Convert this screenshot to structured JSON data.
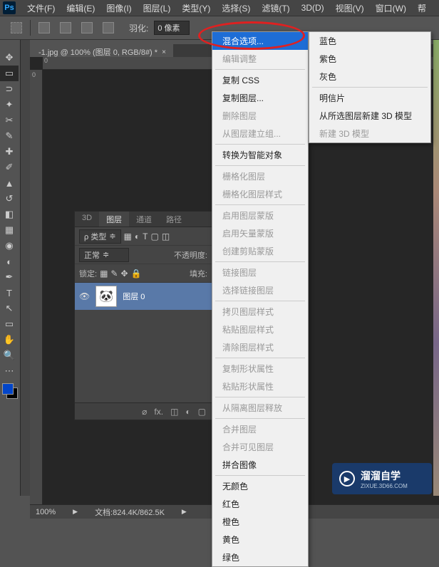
{
  "menubar": {
    "items": [
      "文件(F)",
      "编辑(E)",
      "图像(I)",
      "图层(L)",
      "类型(Y)",
      "选择(S)",
      "滤镜(T)",
      "3D(D)",
      "视图(V)",
      "窗口(W)",
      "帮"
    ]
  },
  "toolbar": {
    "feather_label": "羽化:",
    "feather_value": "0 像素"
  },
  "doc_tab": {
    "title": "-1.jpg @ 100% (图层 0, RGB/8#) *",
    "close": "×"
  },
  "ruler": {
    "ticks_h": [
      "0"
    ],
    "ticks_v": [
      "0"
    ]
  },
  "panel": {
    "tabs": [
      "3D",
      "图层",
      "通道",
      "路径"
    ],
    "kind_label": "ρ 类型",
    "mode": "正常",
    "opacity_label": "不透明度:",
    "lock_label": "锁定:",
    "fill_label": "填充:",
    "layer_name": "图层 0"
  },
  "context_menu": {
    "items": [
      {
        "t": "混合选项...",
        "hl": true
      },
      {
        "t": "编辑调整",
        "d": true
      },
      {
        "sep": true
      },
      {
        "t": "复制 CSS"
      },
      {
        "t": "复制图层..."
      },
      {
        "t": "删除图层",
        "d": true
      },
      {
        "t": "从图层建立组...",
        "d": true
      },
      {
        "sep": true
      },
      {
        "t": "转换为智能对象"
      },
      {
        "sep": true
      },
      {
        "t": "栅格化图层",
        "d": true
      },
      {
        "t": "栅格化图层样式",
        "d": true
      },
      {
        "sep": true
      },
      {
        "t": "启用图层蒙版",
        "d": true
      },
      {
        "t": "启用矢量蒙版",
        "d": true
      },
      {
        "t": "创建剪贴蒙版",
        "d": true
      },
      {
        "sep": true
      },
      {
        "t": "链接图层",
        "d": true
      },
      {
        "t": "选择链接图层",
        "d": true
      },
      {
        "sep": true
      },
      {
        "t": "拷贝图层样式",
        "d": true
      },
      {
        "t": "粘贴图层样式",
        "d": true
      },
      {
        "t": "清除图层样式",
        "d": true
      },
      {
        "sep": true
      },
      {
        "t": "复制形状属性",
        "d": true
      },
      {
        "t": "粘贴形状属性",
        "d": true
      },
      {
        "sep": true
      },
      {
        "t": "从隔离图层释放",
        "d": true
      },
      {
        "sep": true
      },
      {
        "t": "合并图层",
        "d": true
      },
      {
        "t": "合并可见图层",
        "d": true
      },
      {
        "t": "拼合图像"
      },
      {
        "sep": true
      },
      {
        "t": "无颜色"
      },
      {
        "t": "红色"
      },
      {
        "t": "橙色"
      },
      {
        "t": "黄色"
      },
      {
        "t": "绿色"
      }
    ]
  },
  "submenu": {
    "items": [
      {
        "t": "蓝色"
      },
      {
        "t": "紫色"
      },
      {
        "t": "灰色"
      },
      {
        "sep": true
      },
      {
        "t": "明信片"
      },
      {
        "t": "从所选图层新建 3D 模型"
      },
      {
        "t": "新建 3D 模型",
        "d": true
      }
    ]
  },
  "statusbar": {
    "zoom": "100%",
    "doc": "文档:824.4K/862.5K"
  },
  "watermark": {
    "main": "溜溜自学",
    "sub": "ZIXUE.3D66.COM",
    "icon": "▶"
  }
}
